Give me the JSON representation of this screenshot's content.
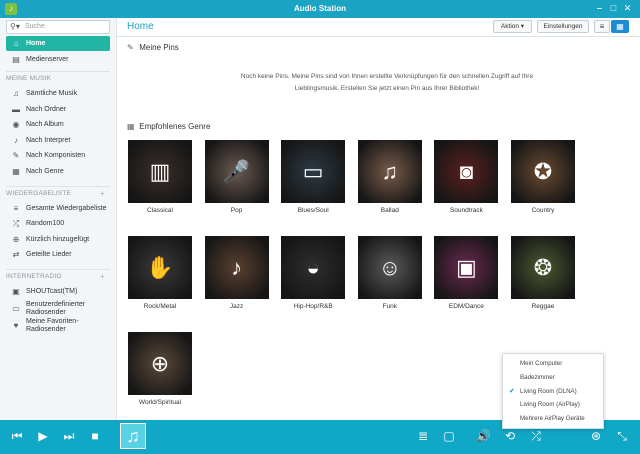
{
  "app": {
    "title": "Audio Station"
  },
  "search": {
    "placeholder": "Suche"
  },
  "sidebar": {
    "top": [
      {
        "label": "Home",
        "icon": "home-icon",
        "glyph": "⌂",
        "active": true
      },
      {
        "label": "Medienserver",
        "icon": "server-icon",
        "glyph": "▤"
      }
    ],
    "sections": [
      {
        "title": "MEINE MUSIK",
        "items": [
          {
            "label": "Sämtliche Musik",
            "glyph": "♫"
          },
          {
            "label": "Nach Ordner",
            "glyph": "▬"
          },
          {
            "label": "Nach Album",
            "glyph": "◉"
          },
          {
            "label": "Nach Interpret",
            "glyph": "♪"
          },
          {
            "label": "Nach Komponisten",
            "glyph": "✎"
          },
          {
            "label": "Nach Genre",
            "glyph": "▦"
          }
        ]
      },
      {
        "title": "WIEDERGABELISTE",
        "items": [
          {
            "label": "Gesamte Wiedergabeliste",
            "glyph": "≡"
          },
          {
            "label": "Random100",
            "glyph": "⤮"
          },
          {
            "label": "Kürzlich hinzugefügt",
            "glyph": "⊕"
          },
          {
            "label": "Geteilte Lieder",
            "glyph": "⇄"
          }
        ]
      },
      {
        "title": "INTERNETRADIO",
        "items": [
          {
            "label": "SHOUTcast(TM)",
            "glyph": "▣"
          },
          {
            "label": "Benutzerdefinierter Radiosender",
            "glyph": "▭"
          },
          {
            "label": "Meine Favoriten-Radiosender",
            "glyph": "♥"
          }
        ]
      }
    ]
  },
  "header": {
    "title": "Home",
    "action_label": "Aktion ▾",
    "settings_label": "Einstellungen"
  },
  "pins": {
    "title": "Meine Pins",
    "empty_line1": "Noch keine Pins. Meine Pins sind von Ihnen erstellte Verknüpfungen für den schnellen Zugriff auf Ihre",
    "empty_line2": "Lieblingsmusik. Erstellen Sie jetzt einen Pin aus Ihrer Bibliothek!"
  },
  "genres": {
    "title": "Empfohlenes Genre",
    "items": [
      {
        "label": "Classical",
        "icon": "piano-icon",
        "glyph": "▥",
        "color": "#3b2f2a"
      },
      {
        "label": "Pop",
        "icon": "microphone-icon",
        "glyph": "🎤",
        "color": "#6b5a52"
      },
      {
        "label": "Blues/Soul",
        "icon": "harmonica-icon",
        "glyph": "▭",
        "color": "#2d3a44"
      },
      {
        "label": "Ballad",
        "icon": "music-note-icon",
        "glyph": "♫",
        "color": "#7a5c4a"
      },
      {
        "label": "Soundtrack",
        "icon": "speakers-icon",
        "glyph": "◙",
        "color": "#5a2020"
      },
      {
        "label": "Country",
        "icon": "guitar-icon",
        "glyph": "✪",
        "color": "#6a4a30"
      },
      {
        "label": "Rock/Metal",
        "icon": "rock-hand-icon",
        "glyph": "✋",
        "color": "#3a3a3a"
      },
      {
        "label": "Jazz",
        "icon": "saxophone-icon",
        "glyph": "♪",
        "color": "#5a4030"
      },
      {
        "label": "Hip-Hop/R&B",
        "icon": "sunglasses-icon",
        "glyph": "◒",
        "color": "#2e2e2e"
      },
      {
        "label": "Funk",
        "icon": "afro-icon",
        "glyph": "☺",
        "color": "#5a5a5a"
      },
      {
        "label": "EDM/Dance",
        "icon": "boombox-icon",
        "glyph": "▣",
        "color": "#6a2a50"
      },
      {
        "label": "Reggae",
        "icon": "lion-icon",
        "glyph": "❂",
        "color": "#4a5a30"
      },
      {
        "label": "World/Spiritual",
        "icon": "globe-icon",
        "glyph": "⊕",
        "color": "#5a4a3a"
      }
    ]
  },
  "output_menu": {
    "items": [
      {
        "label": "Mein Computer",
        "checked": false
      },
      {
        "label": "Badezimmer",
        "checked": false
      },
      {
        "label": "Living Room (DLNA)",
        "checked": true
      },
      {
        "label": "Living Room (AirPlay)",
        "checked": false
      },
      {
        "label": "Mehrere AirPlay Geräte",
        "checked": false
      }
    ]
  },
  "player": {
    "cover_icon": "music-note-icon",
    "colors": {
      "bar": "#11a7c6",
      "accent": "#20b6a3"
    }
  }
}
